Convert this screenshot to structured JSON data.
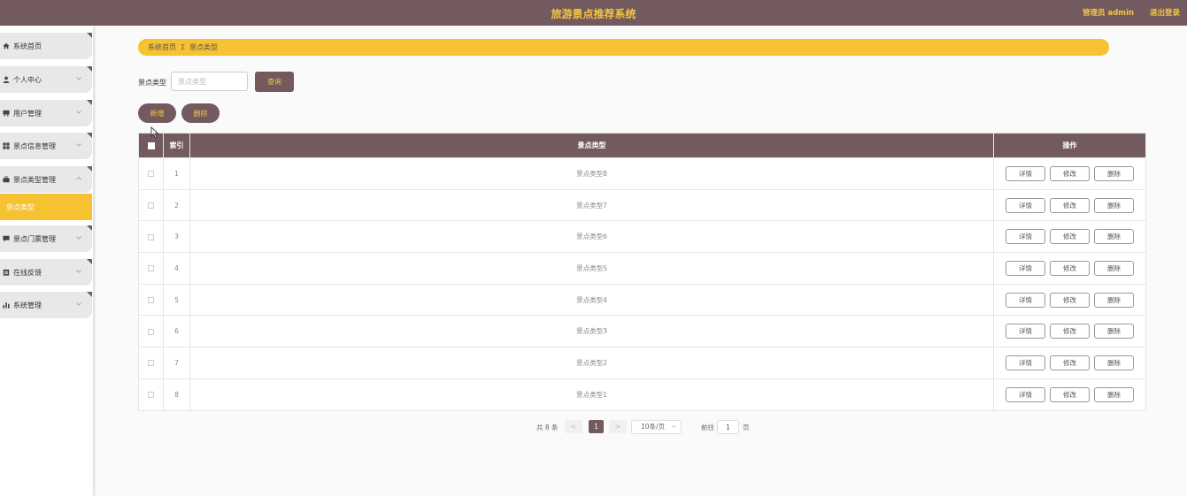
{
  "header": {
    "title": "旅游景点推荐系统",
    "admin_label": "管理员 admin",
    "logout_label": "退出登录"
  },
  "sidebar": {
    "items": [
      {
        "label": "系统首页",
        "icon": "home-icon",
        "expandable": false
      },
      {
        "label": "个人中心",
        "icon": "user-icon",
        "expandable": true
      },
      {
        "label": "用户管理",
        "icon": "users-icon",
        "expandable": true
      },
      {
        "label": "景点信息管理",
        "icon": "grid-icon",
        "expandable": true
      },
      {
        "label": "景点类型管理",
        "icon": "briefcase-icon",
        "expandable": true,
        "expanded": true
      },
      {
        "label": "景点类型",
        "sub": true,
        "active": true
      },
      {
        "label": "景点门票管理",
        "icon": "chat-icon",
        "expandable": true
      },
      {
        "label": "在线反馈",
        "icon": "clipboard-icon",
        "expandable": true
      },
      {
        "label": "系统管理",
        "icon": "chart-icon",
        "expandable": true
      }
    ]
  },
  "breadcrumb": {
    "home": "系统首页",
    "separator": "Σ",
    "current": "景点类型"
  },
  "search": {
    "label": "景点类型",
    "placeholder": "景点类型",
    "query_button": "查询"
  },
  "actions": {
    "add_button": "新增",
    "delete_button": "删除"
  },
  "table": {
    "headers": {
      "index": "索引",
      "type": "景点类型",
      "ops": "操作"
    },
    "rows": [
      {
        "index": "1",
        "type": "景点类型8"
      },
      {
        "index": "2",
        "type": "景点类型7"
      },
      {
        "index": "3",
        "type": "景点类型6"
      },
      {
        "index": "4",
        "type": "景点类型5"
      },
      {
        "index": "5",
        "type": "景点类型4"
      },
      {
        "index": "6",
        "type": "景点类型3"
      },
      {
        "index": "7",
        "type": "景点类型2"
      },
      {
        "index": "8",
        "type": "景点类型1"
      }
    ],
    "row_buttons": {
      "detail": "详情",
      "edit": "修改",
      "delete": "删除"
    }
  },
  "pagination": {
    "total": "共 8 条",
    "prev": "<",
    "current_page": "1",
    "next": ">",
    "page_size": "10条/页",
    "goto_label": "前往",
    "goto_value": "1",
    "page_suffix": "页"
  },
  "colors": {
    "primary": "#725a5e",
    "accent": "#f6c232"
  }
}
